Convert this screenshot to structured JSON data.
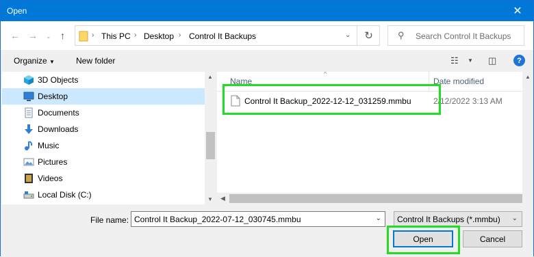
{
  "window": {
    "title": "Open"
  },
  "address": {
    "crumbs": [
      "This PC",
      "Desktop",
      "Control It Backups"
    ]
  },
  "search": {
    "placeholder": "Search Control It Backups"
  },
  "toolbar": {
    "organize": "Organize",
    "new_folder": "New folder"
  },
  "nav": {
    "items": [
      {
        "label": "3D Objects",
        "icon": "3d-objects-icon"
      },
      {
        "label": "Desktop",
        "icon": "desktop-icon",
        "selected": true
      },
      {
        "label": "Documents",
        "icon": "documents-icon"
      },
      {
        "label": "Downloads",
        "icon": "downloads-icon"
      },
      {
        "label": "Music",
        "icon": "music-icon"
      },
      {
        "label": "Pictures",
        "icon": "pictures-icon"
      },
      {
        "label": "Videos",
        "icon": "videos-icon"
      },
      {
        "label": "Local Disk (C:)",
        "icon": "local-disk-icon"
      }
    ]
  },
  "files": {
    "columns": {
      "name": "Name",
      "date": "Date modified"
    },
    "rows": [
      {
        "name": "Control It Backup_2022-12-12_031259.mmbu",
        "date": "2/12/2022 3:13 AM"
      }
    ]
  },
  "bottom": {
    "file_name_label": "File name:",
    "file_name_value": "Control It Backup_2022-07-12_030745.mmbu",
    "filter": "Control It Backups (*.mmbu)",
    "open": "Open",
    "cancel": "Cancel"
  },
  "colors": {
    "accent": "#0078d7",
    "highlight": "#22dd22",
    "selected_bg": "#cce8ff"
  }
}
